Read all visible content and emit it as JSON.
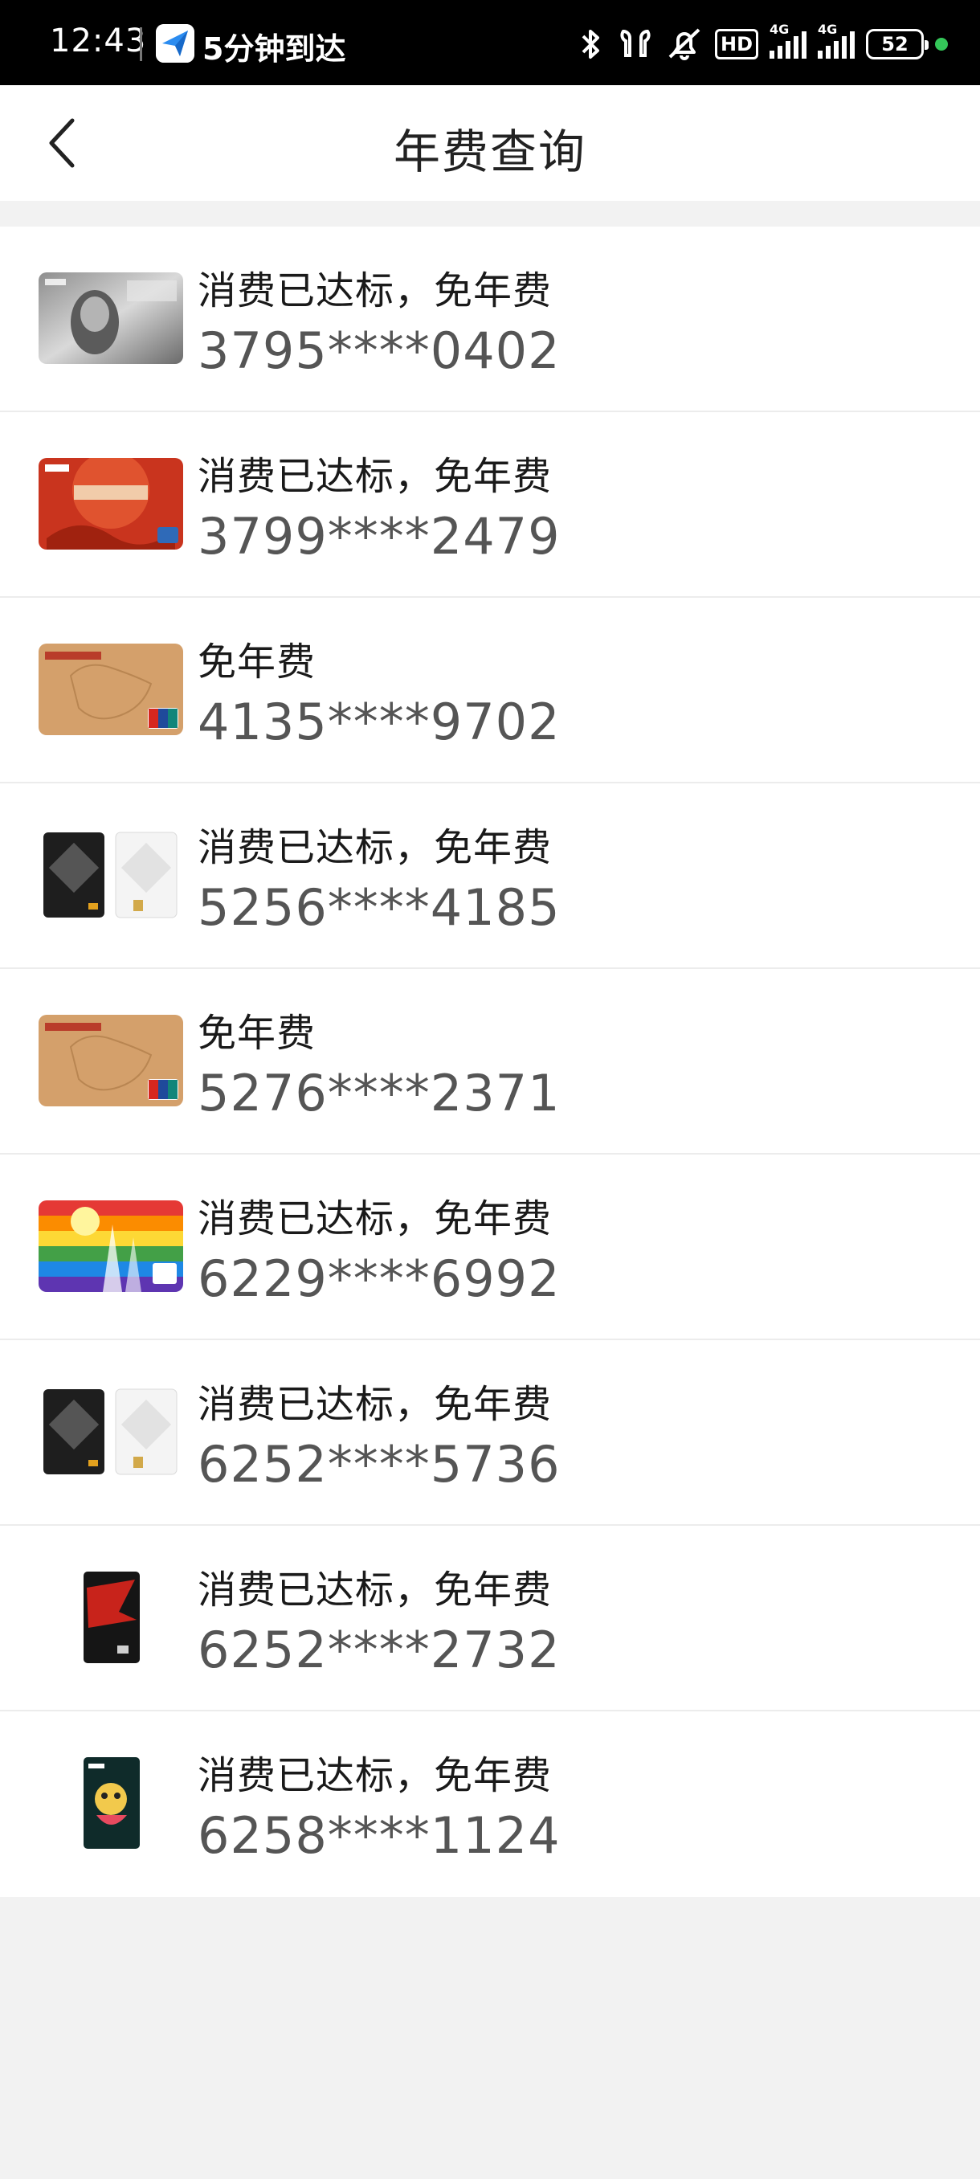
{
  "status_bar": {
    "time": "12:43",
    "notification_text": "5分钟到达",
    "network_1": "4G",
    "network_2": "4G",
    "hd_label": "HD",
    "battery": "52",
    "dot_color": "#34c759"
  },
  "nav": {
    "back_icon": "chevron-left-icon",
    "title": "年费查询"
  },
  "cards": [
    {
      "status": "消费已达标，免年费",
      "number": "3795****0402",
      "art": "amex-platinum"
    },
    {
      "status": "消费已达标，免年费",
      "number": "3799****2479",
      "art": "universal-red"
    },
    {
      "status": "免年费",
      "number": "4135****9702",
      "art": "icbc-gold-unionpay"
    },
    {
      "status": "消费已达标，免年费",
      "number": "5256****4185",
      "art": "black-white-pair"
    },
    {
      "status": "免年费",
      "number": "5276****2371",
      "art": "icbc-gold-unionpay"
    },
    {
      "status": "消费已达标，免年费",
      "number": "6229****6992",
      "art": "rainbow-city"
    },
    {
      "status": "消费已达标，免年费",
      "number": "6252****5736",
      "art": "black-white-pair"
    },
    {
      "status": "消费已达标，免年费",
      "number": "6252****2732",
      "art": "vertical-red-black"
    },
    {
      "status": "消费已达标，免年费",
      "number": "6258****1124",
      "art": "vertical-dark-cartoon"
    }
  ],
  "colors": {
    "background": "#f2f2f2",
    "row_divider": "#ececec",
    "card_number": "#555555"
  }
}
